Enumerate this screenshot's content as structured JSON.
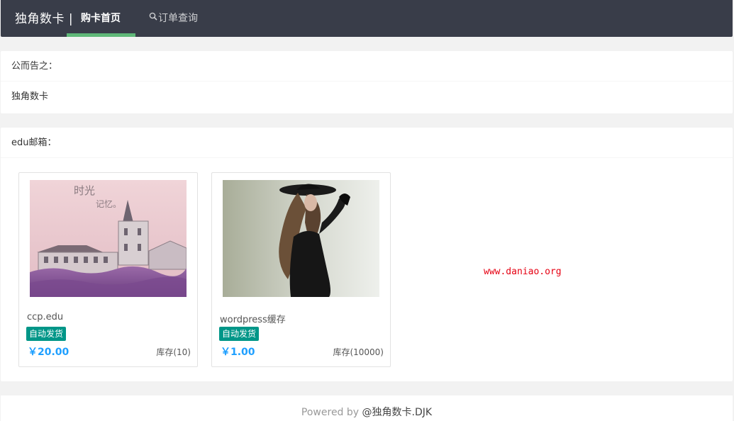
{
  "nav": {
    "brand": "独角数卡 |",
    "home_label": "购卡首页",
    "order_label": "订单查询",
    "accent_color": "#5fb878",
    "bg_color": "#393d49"
  },
  "notice": {
    "title": "公而告之：",
    "content": "独角数卡"
  },
  "category": {
    "title": "edu邮箱："
  },
  "products": [
    {
      "name": "ccp.edu",
      "badge": "自动发货",
      "price": "￥20.00",
      "stock": "库存(10)"
    },
    {
      "name": "wordpress缓存",
      "badge": "自动发货",
      "price": "￥1.00",
      "stock": "库存(10000)"
    }
  ],
  "product1_image": {
    "text_top": "时光",
    "text_bottom": "记忆。"
  },
  "watermark": "www.daniao.org",
  "footer": {
    "powered": "Powered by ",
    "author": "@独角数卡.DJK"
  },
  "colors": {
    "badge": "#009688",
    "price": "#1e9fff",
    "watermark": "#e60012"
  }
}
